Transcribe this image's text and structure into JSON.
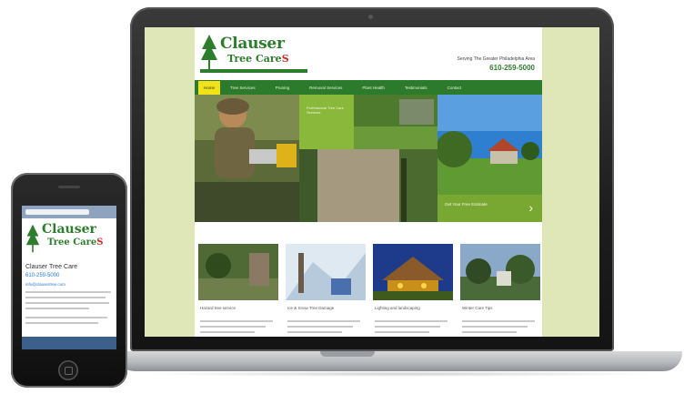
{
  "site": {
    "logo_line1": "Clauser",
    "logo_line2": "Tree Care",
    "logo_suffix": "S",
    "header_tagline": "Serving The Greater Philadelphia Area",
    "header_phone": "610-259-5000",
    "nav": [
      "Home",
      "Tree Services",
      "Pruning",
      "Removal Services",
      "Plant Health",
      "Testimonials",
      "Contact"
    ],
    "hero_panel_text": "Professional Tree Care Services",
    "hero_cta_text": "Get Your Free Estimate",
    "hero_cta_arrow": "›",
    "thumbnails": [
      {
        "title": "Hazard tree service"
      },
      {
        "title": "Ice & Snow Tree Damage"
      },
      {
        "title": "Lighting and landscaping"
      },
      {
        "title": "Winter Care Tips"
      }
    ]
  },
  "phone": {
    "logo_line1": "Clauser",
    "logo_line2": "Tree Care",
    "logo_suffix": "S",
    "title": "Clauser Tree Care",
    "phone": "610-259-5000",
    "link": "info@clausertree.com"
  },
  "colors": {
    "brand_green": "#2e7d2e",
    "nav_green": "#2c7a2c",
    "accent_yellow": "#f2e21a",
    "accent_red": "#d12a2a",
    "page_bg": "#dfe6b8"
  }
}
